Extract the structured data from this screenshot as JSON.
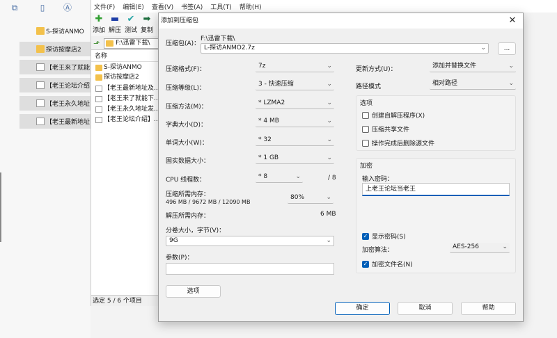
{
  "explorer": {
    "items": [
      {
        "label": "S-探访ANMO",
        "icon": "folder-icon",
        "selected": false
      },
      {
        "label": "探访按摩店2",
        "icon": "folder-icon",
        "selected": true
      },
      {
        "label": "【老王来了就能",
        "icon": "document-icon",
        "selected": true
      },
      {
        "label": "【老王论坛介绍",
        "icon": "document-icon",
        "selected": true
      },
      {
        "label": "【老王永久地址",
        "icon": "document-icon",
        "selected": true
      },
      {
        "label": "【老王最新地址",
        "icon": "document-icon",
        "selected": true
      }
    ]
  },
  "filemanager": {
    "menu": [
      "文件(F)",
      "编辑(E)",
      "查看(V)",
      "书签(A)",
      "工具(T)",
      "帮助(H)"
    ],
    "tools": [
      {
        "label": "添加",
        "icon": "plus-icon",
        "glyph": "✚",
        "color": "#2f9e2f"
      },
      {
        "label": "解压",
        "icon": "minus-icon",
        "glyph": "▬",
        "color": "#1f3fa8"
      },
      {
        "label": "测试",
        "icon": "check-icon",
        "glyph": "✔",
        "color": "#2aa6a6"
      },
      {
        "label": "复制",
        "icon": "arrow-right-icon",
        "glyph": "➡",
        "color": "#1f6f3f"
      }
    ],
    "path": "F:\\迅雷下载\\",
    "column_name": "名称",
    "rows": [
      {
        "label": "S-探访ANMO",
        "icon": "folder-icon"
      },
      {
        "label": "探访按摩店2",
        "icon": "folder-icon"
      },
      {
        "label": "【老王最新地址及...",
        "icon": "document-icon"
      },
      {
        "label": "【老王来了就能下...",
        "icon": "document-icon"
      },
      {
        "label": "【老王永久地址发...",
        "icon": "document-icon"
      },
      {
        "label": "【老王论坛介绍】...",
        "icon": "document-icon"
      }
    ],
    "status": "选定 5 / 6 个项目"
  },
  "dialog": {
    "title": "添加到压缩包",
    "archive_label": "压缩包(A)：",
    "archive_dir": "F:\\迅雷下载\\",
    "archive_name": "L-探访ANMO2.7z",
    "browse_label": "...",
    "format_label": "压缩格式(F)：",
    "format_value": "7z",
    "level_label": "压缩等级(L)：",
    "level_value": "3 - 快速压缩",
    "method_label": "压缩方法(M)：",
    "method_value": "* LZMA2",
    "dict_label": "字典大小(D)：",
    "dict_value": "* 4 MB",
    "word_label": "单词大小(W)：",
    "word_value": "* 32",
    "solid_label": "固实数据大小：",
    "solid_value": "* 1 GB",
    "cpu_label": "CPU 线程数：",
    "cpu_value": "* 8",
    "cpu_max": "/ 8",
    "mem_comp_label": "压缩所需内存：",
    "mem_comp_value": "496 MB / 9672 MB / 12090 MB",
    "mem_percent": "80%",
    "mem_decomp_label": "解压所需内存：",
    "mem_decomp_value": "6 MB",
    "split_label": "分卷大小，字节(V)：",
    "split_value": "9G",
    "params_label": "参数(P)：",
    "params_value": "",
    "options_button": "选项",
    "update_label": "更新方式(U)：",
    "update_value": "添加并替换文件",
    "path_mode_label": "路径模式",
    "path_mode_value": "相对路径",
    "options_group_title": "选项",
    "opt_sfx": "创建自解压程序(X)",
    "opt_shared": "压缩共享文件",
    "opt_delete": "操作完成后删除源文件",
    "encrypt_group_title": "加密",
    "password_label": "输入密码：",
    "password_value": "上老王论坛当老王",
    "show_password": "显示密码(S)",
    "enc_method_label": "加密算法：",
    "enc_method_value": "AES-256",
    "encrypt_names": "加密文件名(N)",
    "ok": "确定",
    "cancel": "取消",
    "help": "帮助"
  },
  "colors": {
    "accent": "#005fb8",
    "folder": "#f3c14b"
  }
}
